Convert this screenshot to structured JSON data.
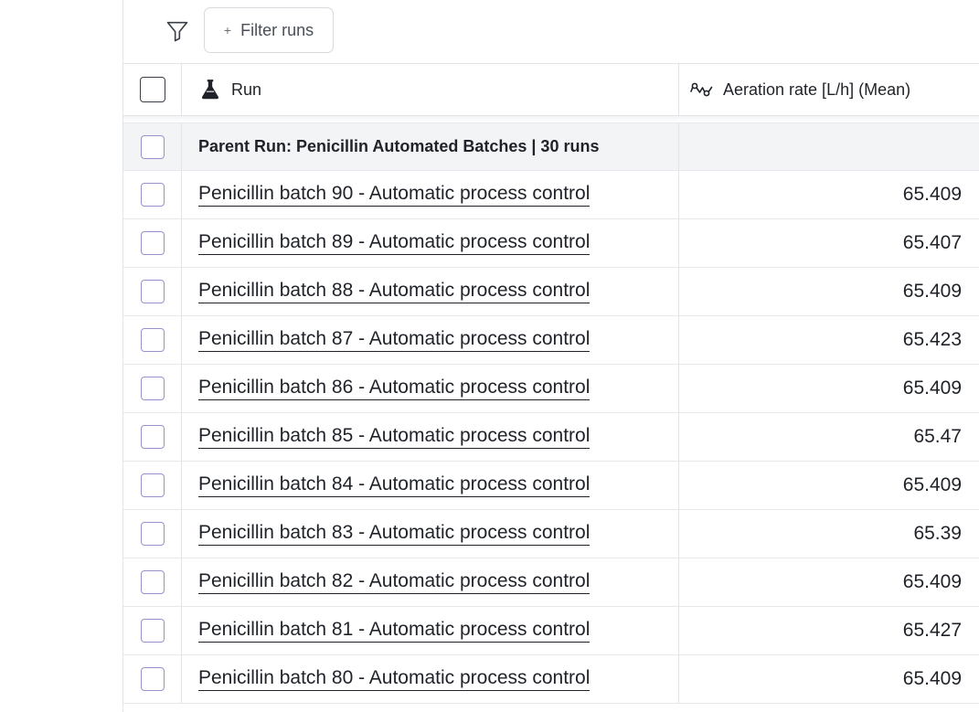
{
  "filter": {
    "icon": "funnel-icon",
    "button_plus": "+",
    "button_label": "Filter runs"
  },
  "table": {
    "columns": {
      "run": {
        "label": "Run",
        "icon": "flask-icon"
      },
      "metric": {
        "label": "Aeration rate [L/h] (Mean)",
        "icon": "metric-line-icon"
      }
    },
    "group": {
      "label": "Parent Run: Penicillin Automated Batches | 30 runs"
    },
    "rows": [
      {
        "name": "Penicillin batch 90 - Automatic process control",
        "value": "65.409"
      },
      {
        "name": "Penicillin batch 89 - Automatic process control",
        "value": "65.407"
      },
      {
        "name": "Penicillin batch 88 - Automatic process control",
        "value": "65.409"
      },
      {
        "name": "Penicillin batch 87 - Automatic process control",
        "value": "65.423"
      },
      {
        "name": "Penicillin batch 86 - Automatic process control",
        "value": "65.409"
      },
      {
        "name": "Penicillin batch 85 - Automatic process control",
        "value": "65.47"
      },
      {
        "name": "Penicillin batch 84 - Automatic process control",
        "value": "65.409"
      },
      {
        "name": "Penicillin batch 83 - Automatic process control",
        "value": "65.39"
      },
      {
        "name": "Penicillin batch 82 - Automatic process control",
        "value": "65.409"
      },
      {
        "name": "Penicillin batch 81 - Automatic process control",
        "value": "65.427"
      },
      {
        "name": "Penicillin batch 80 - Automatic process control",
        "value": "65.409"
      }
    ]
  }
}
